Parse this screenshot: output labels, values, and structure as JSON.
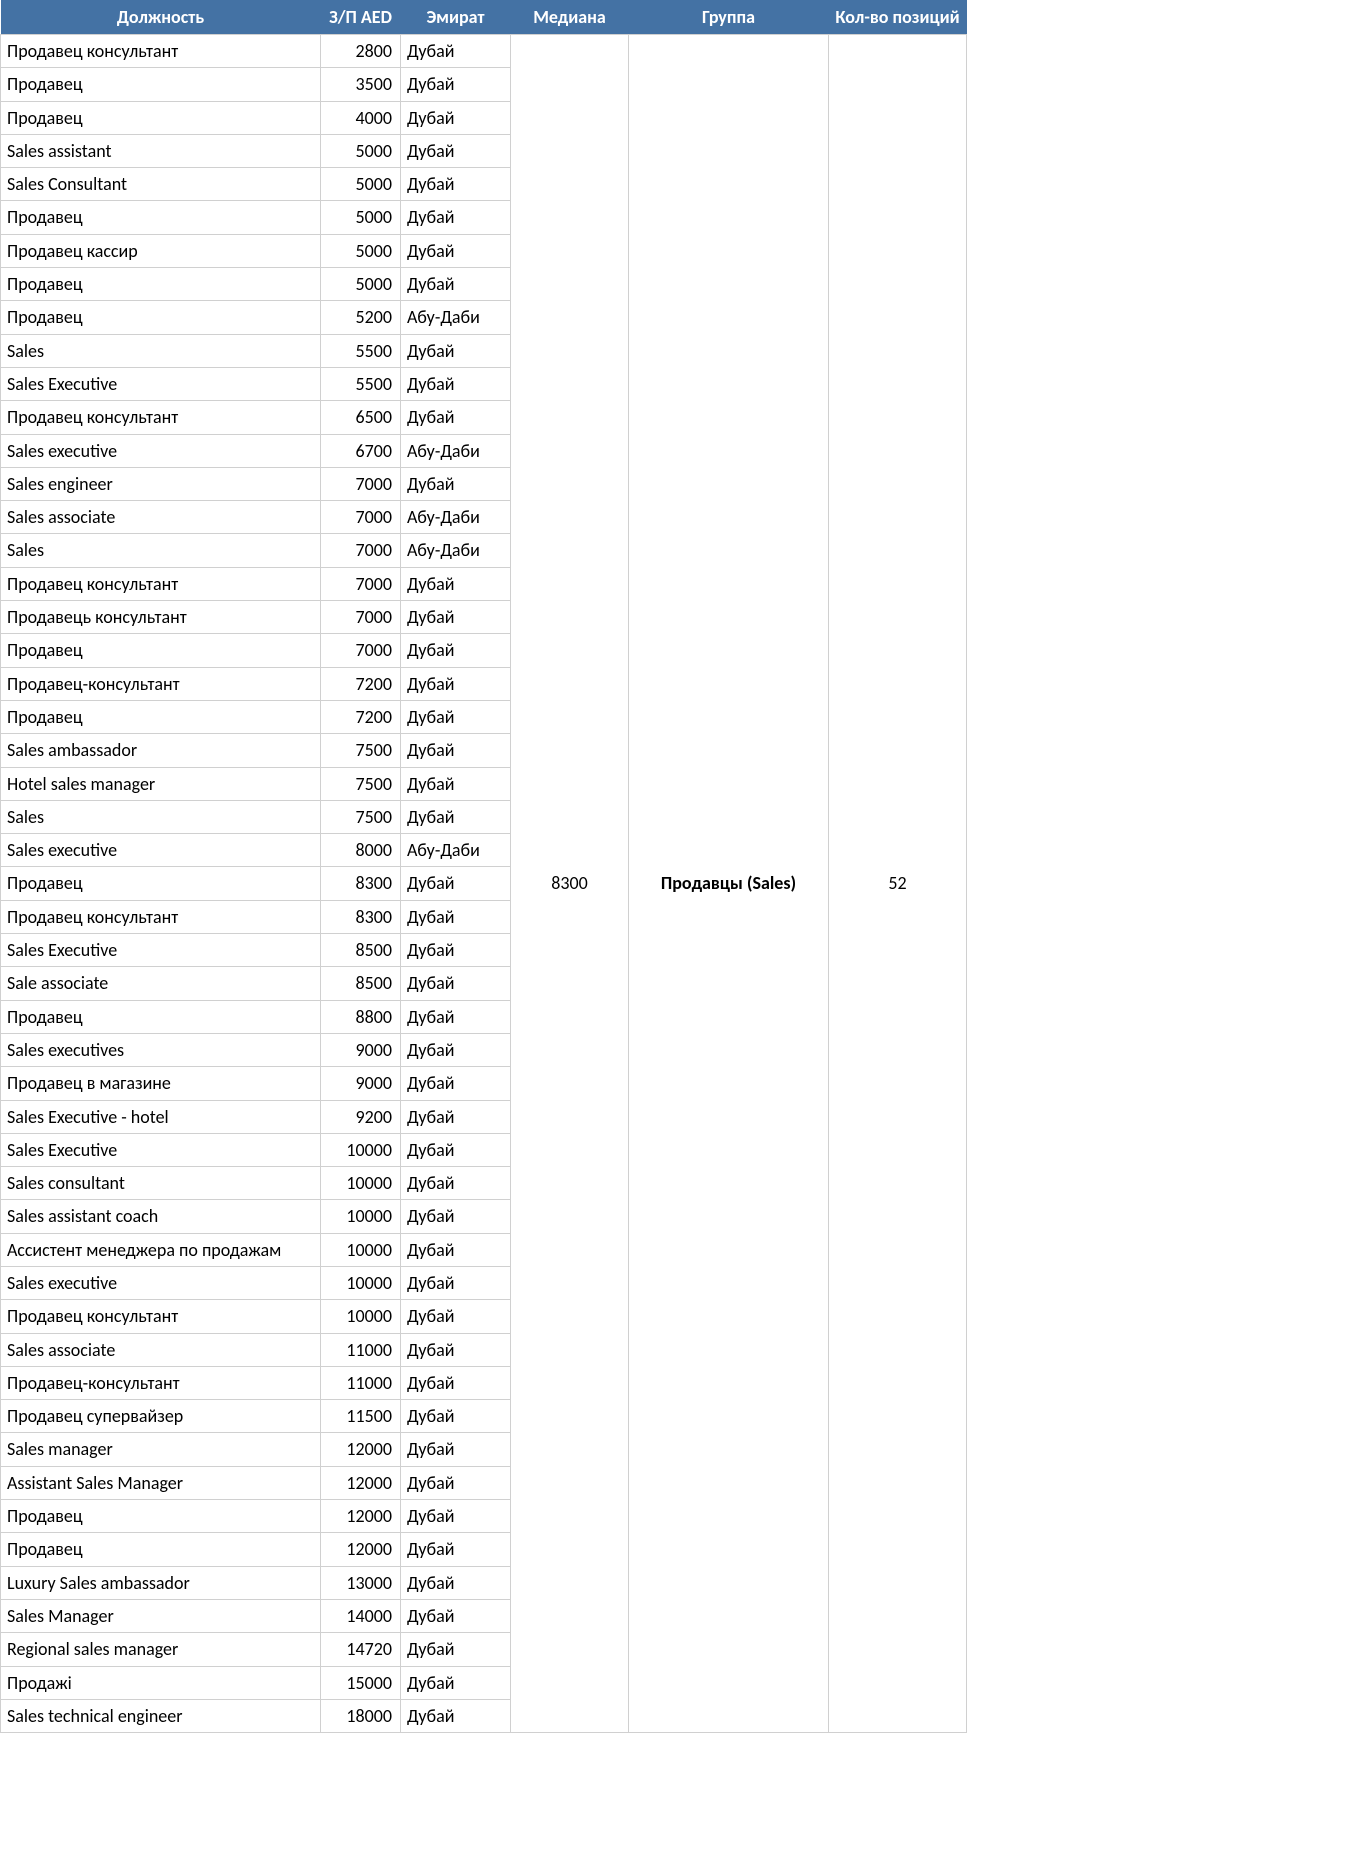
{
  "headers": {
    "position": "Должность",
    "salary": "З/П AED",
    "emirate": "Эмират",
    "median": "Медиана",
    "group": "Группа",
    "count": "Кол-во позиций"
  },
  "median": "8300",
  "group": "Продавцы (Sales)",
  "count": "52",
  "rows": [
    {
      "position": "Продавец консультант",
      "salary": "2800",
      "emirate": "Дубай"
    },
    {
      "position": "Продавец",
      "salary": "3500",
      "emirate": "Дубай"
    },
    {
      "position": "Продавец",
      "salary": "4000",
      "emirate": "Дубай"
    },
    {
      "position": "Sales assistant",
      "salary": "5000",
      "emirate": "Дубай"
    },
    {
      "position": "Sales Consultant",
      "salary": "5000",
      "emirate": "Дубай"
    },
    {
      "position": "Продавец",
      "salary": "5000",
      "emirate": "Дубай"
    },
    {
      "position": "Продавец кассир",
      "salary": "5000",
      "emirate": "Дубай"
    },
    {
      "position": "Продавец",
      "salary": "5000",
      "emirate": "Дубай"
    },
    {
      "position": "Продавец",
      "salary": "5200",
      "emirate": "Абу-Даби"
    },
    {
      "position": "Sales",
      "salary": "5500",
      "emirate": "Дубай"
    },
    {
      "position": "Sales Executive",
      "salary": "5500",
      "emirate": "Дубай"
    },
    {
      "position": "Продавец консультант",
      "salary": "6500",
      "emirate": "Дубай"
    },
    {
      "position": "Sales executive",
      "salary": "6700",
      "emirate": "Абу-Даби"
    },
    {
      "position": "Sales engineer",
      "salary": "7000",
      "emirate": "Дубай"
    },
    {
      "position": "Sales associate",
      "salary": "7000",
      "emirate": "Абу-Даби"
    },
    {
      "position": "Sales",
      "salary": "7000",
      "emirate": "Абу-Даби"
    },
    {
      "position": "Продавец консультант",
      "salary": "7000",
      "emirate": "Дубай"
    },
    {
      "position": "Продавець консультант",
      "salary": "7000",
      "emirate": "Дубай"
    },
    {
      "position": "Продавец",
      "salary": "7000",
      "emirate": "Дубай"
    },
    {
      "position": "Продавец-консультант",
      "salary": "7200",
      "emirate": "Дубай"
    },
    {
      "position": "Продавец",
      "salary": "7200",
      "emirate": "Дубай"
    },
    {
      "position": "Sales ambassador",
      "salary": "7500",
      "emirate": "Дубай"
    },
    {
      "position": "Hotel sales manager",
      "salary": "7500",
      "emirate": "Дубай"
    },
    {
      "position": "Sales",
      "salary": "7500",
      "emirate": "Дубай"
    },
    {
      "position": "Sales executive",
      "salary": "8000",
      "emirate": "Абу-Даби"
    },
    {
      "position": "Продавец",
      "salary": "8300",
      "emirate": "Дубай"
    },
    {
      "position": "Продавец консультант",
      "salary": "8300",
      "emirate": "Дубай"
    },
    {
      "position": "Sales Executive",
      "salary": "8500",
      "emirate": "Дубай"
    },
    {
      "position": "Sale associate",
      "salary": "8500",
      "emirate": "Дубай"
    },
    {
      "position": "Продавец",
      "salary": "8800",
      "emirate": "Дубай"
    },
    {
      "position": "Sales executives",
      "salary": "9000",
      "emirate": "Дубай"
    },
    {
      "position": "Продавец в магазине",
      "salary": "9000",
      "emirate": "Дубай"
    },
    {
      "position": "Sales Executive - hotel",
      "salary": "9200",
      "emirate": "Дубай"
    },
    {
      "position": "Sales Executive",
      "salary": "10000",
      "emirate": "Дубай"
    },
    {
      "position": "Sales consultant",
      "salary": "10000",
      "emirate": "Дубай"
    },
    {
      "position": "Sales assistant coach",
      "salary": "10000",
      "emirate": "Дубай"
    },
    {
      "position": "Ассистент менеджера по продажам",
      "salary": "10000",
      "emirate": "Дубай"
    },
    {
      "position": "Sales executive",
      "salary": "10000",
      "emirate": "Дубай"
    },
    {
      "position": "Продавец консультант",
      "salary": "10000",
      "emirate": "Дубай"
    },
    {
      "position": "Sales associate",
      "salary": "11000",
      "emirate": "Дубай"
    },
    {
      "position": "Продавец-консультант",
      "salary": "11000",
      "emirate": "Дубай"
    },
    {
      "position": "Продавец супервайзер",
      "salary": "11500",
      "emirate": "Дубай"
    },
    {
      "position": "Sales manager",
      "salary": "12000",
      "emirate": "Дубай"
    },
    {
      "position": "Assistant Sales Manager",
      "salary": "12000",
      "emirate": "Дубай"
    },
    {
      "position": "Продавец",
      "salary": "12000",
      "emirate": "Дубай"
    },
    {
      "position": "Продавец",
      "salary": "12000",
      "emirate": "Дубай"
    },
    {
      "position": "Luxury Sales ambassador",
      "salary": "13000",
      "emirate": "Дубай"
    },
    {
      "position": "Sales Manager",
      "salary": "14000",
      "emirate": "Дубай"
    },
    {
      "position": "Regional sales manager",
      "salary": "14720",
      "emirate": "Дубай"
    },
    {
      "position": "Продажі",
      "salary": "15000",
      "emirate": "Дубай"
    },
    {
      "position": "Sales technical engineer",
      "salary": "18000",
      "emirate": "Дубай"
    }
  ]
}
